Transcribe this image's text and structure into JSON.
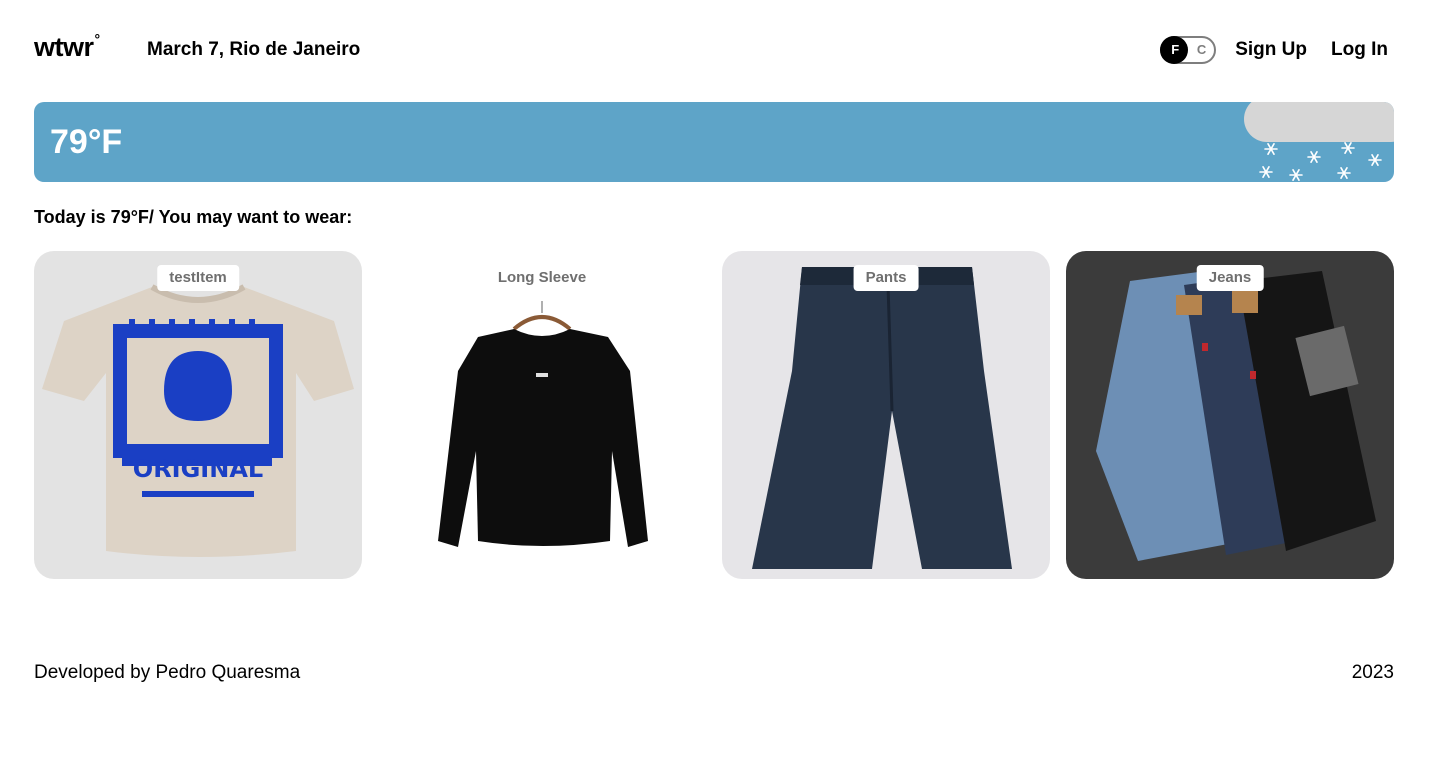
{
  "header": {
    "logo_text": "wtwr",
    "logo_mark": "°",
    "date_location": "March 7, Rio de Janeiro",
    "unit_toggle": {
      "option_f": "F",
      "option_c": "C",
      "selected": "F"
    },
    "sign_up": "Sign Up",
    "log_in": "Log In"
  },
  "weather": {
    "temperature": "79°F",
    "condition_icon": "cloud-snow-icon"
  },
  "recommendation": {
    "text": "Today is 79°F/ You may want to wear:"
  },
  "items": [
    {
      "label": "testItem",
      "image": "beige-tshirt-image"
    },
    {
      "label": "Long Sleeve",
      "image": "black-long-sleeve-image"
    },
    {
      "label": "Pants",
      "image": "dark-pants-image"
    },
    {
      "label": "Jeans",
      "image": "jeans-stack-image"
    }
  ],
  "footer": {
    "credit": "Developed by Pedro Quaresma",
    "year": "2023"
  },
  "colors": {
    "banner": "#5ea4c8",
    "cloud": "#d6d6d6",
    "toggle_knob": "#000000",
    "toggle_border": "#7e7e7e",
    "label_text": "#6f6f6f"
  }
}
